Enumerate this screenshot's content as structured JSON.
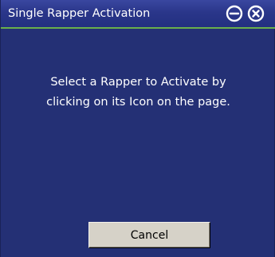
{
  "dialog": {
    "title": "Single Rapper Activation",
    "message_line1": "Select a Rapper to Activate by",
    "message_line2": "clicking on its Icon on the page.",
    "cancel_label": "Cancel"
  },
  "icons": {
    "minimize": "minus-circle-icon",
    "close": "x-circle-icon"
  },
  "colors": {
    "background": "#243075",
    "titlebar": "#2a368a",
    "accent_line": "#6ab04c",
    "text": "#ffffff",
    "button": "#d6d2c8"
  }
}
